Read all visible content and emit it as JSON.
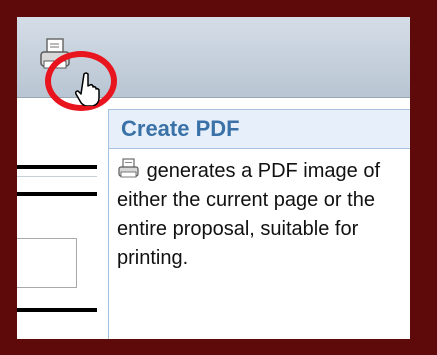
{
  "tooltip": {
    "title": "Create PDF",
    "body": "generates a PDF image of either the current page or the entire proposal, suitable for printing."
  },
  "icons": {
    "toolbar_button": "printer-icon",
    "cursor": "hand-pointer-icon",
    "inline": "printer-icon"
  },
  "colors": {
    "frame": "#5e0a0a",
    "highlight": "#e8141e",
    "tooltip_title": "#3a72a8",
    "tooltip_header_bg": "#e7f0fa"
  }
}
